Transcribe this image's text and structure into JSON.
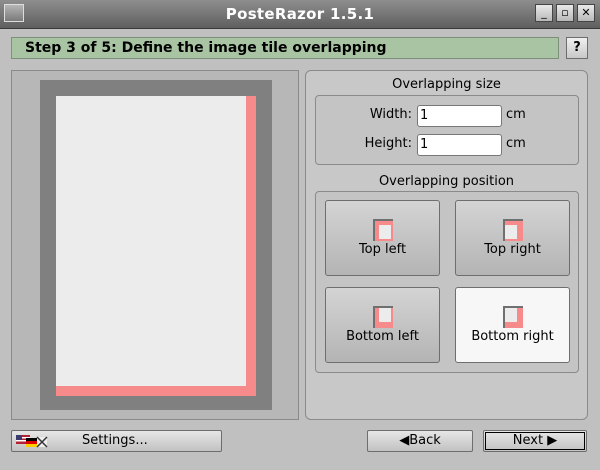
{
  "window": {
    "title": "PosteRazor 1.5.1",
    "controls": [
      "_",
      "▫",
      "✕"
    ]
  },
  "step": {
    "title": "Step 3 of 5: Define the image tile overlapping",
    "help_label": "?"
  },
  "overlapping_size": {
    "title": "Overlapping size",
    "width_label": "Width:",
    "width_value": "1",
    "width_unit": "cm",
    "height_label": "Height:",
    "height_value": "1",
    "height_unit": "cm"
  },
  "overlapping_position": {
    "title": "Overlapping position",
    "options": [
      "Top left",
      "Top right",
      "Bottom left",
      "Bottom right"
    ],
    "selected": "Bottom right"
  },
  "footer": {
    "settings_label": "Settings...",
    "back_label": "Back",
    "back_icon": "◀",
    "next_label": "Next",
    "next_icon": "▶"
  },
  "colors": {
    "overlap": "#f78b8b",
    "step_bar": "#a8c4a2"
  }
}
